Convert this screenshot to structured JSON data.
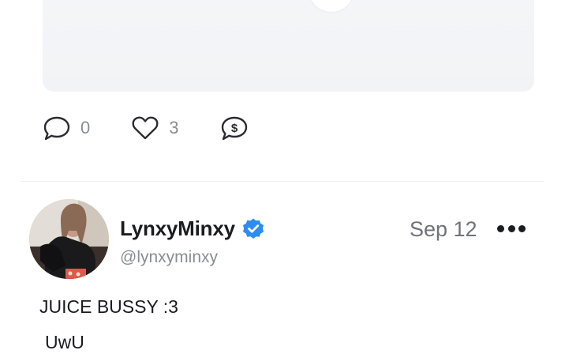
{
  "colors": {
    "verified_blue": "#2d8cf0",
    "muted_text": "#8a8d94",
    "primary_text": "#1b1c20"
  },
  "previous_post": {
    "comment_count": "0",
    "like_count": "3",
    "icons": [
      "comment-icon",
      "heart-icon",
      "tip-dollar-icon"
    ]
  },
  "post": {
    "display_name": "LynxyMinxy",
    "handle": "@lynxyminxy",
    "date": "Sep 12",
    "verified": true,
    "text_line1": "JUICE BUSSY :3",
    "text_line2": "UwU"
  }
}
